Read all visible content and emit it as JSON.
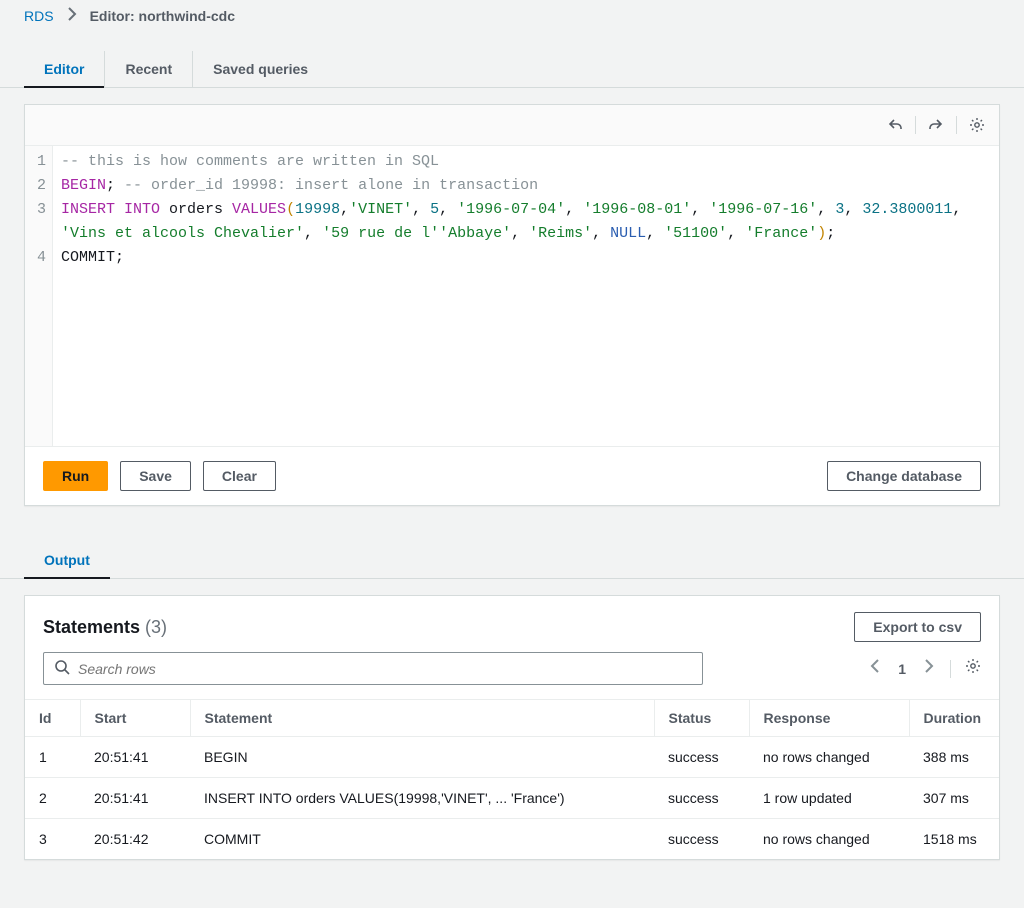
{
  "breadcrumb": {
    "root": "RDS",
    "current": "Editor: northwind-cdc"
  },
  "tabs": {
    "editor": "Editor",
    "recent": "Recent",
    "saved": "Saved queries"
  },
  "editor": {
    "line_numbers": [
      "1",
      "2",
      "3",
      "4"
    ],
    "l1_comment": "-- this is how comments are written in SQL",
    "l2_kw": "BEGIN",
    "l2_semi": ";",
    "l2_comment": " -- order_id 19998: insert alone in transaction",
    "l3_insert": "INSERT INTO",
    "l3_table": " orders ",
    "l3_values": "VALUES",
    "l3_open": "(",
    "l3_v1": "19998",
    "l3_c1": ",",
    "l3_v2": "'VINET'",
    "l3_c2": ", ",
    "l3_v3": "5",
    "l3_c3": ", ",
    "l3_v4": "'1996-07-04'",
    "l3_c4": ", ",
    "l3_v5": "'1996-08-01'",
    "l3_c5": ", ",
    "l3_v6": "'1996-07-16'",
    "l3_c6": ", ",
    "l3_v7": "3",
    "l3_c7": ", ",
    "l3_v8": "32.3800011",
    "l3_c8": ", ",
    "l3_v9": "'Vins et alcools Chevalier'",
    "l3_c9": ", ",
    "l3_v10": "'59 rue de l''Abbaye'",
    "l3_c10": ", ",
    "l3_v11": "'Reims'",
    "l3_c11": ", ",
    "l3_v12": "NULL",
    "l3_c12": ", ",
    "l3_v13": "'51100'",
    "l3_c13": ", ",
    "l3_v14": "'France'",
    "l3_close": ")",
    "l3_semi": ";",
    "l4": "COMMIT;"
  },
  "buttons": {
    "run": "Run",
    "save": "Save",
    "clear": "Clear",
    "change_db": "Change database"
  },
  "output_tab": "Output",
  "statements": {
    "title": "Statements",
    "count": "(3)",
    "export": "Export to csv",
    "search_placeholder": "Search rows",
    "page": "1",
    "columns": {
      "id": "Id",
      "start": "Start",
      "statement": "Statement",
      "status": "Status",
      "response": "Response",
      "duration": "Duration"
    },
    "rows": [
      {
        "id": "1",
        "start": "20:51:41",
        "statement": "BEGIN",
        "status": "success",
        "response": "no rows changed",
        "duration": "388 ms"
      },
      {
        "id": "2",
        "start": "20:51:41",
        "statement": "INSERT INTO orders VALUES(19998,'VINET', ... 'France')",
        "status": "success",
        "response": "1 row updated",
        "duration": "307 ms"
      },
      {
        "id": "3",
        "start": "20:51:42",
        "statement": "COMMIT",
        "status": "success",
        "response": "no rows changed",
        "duration": "1518 ms"
      }
    ]
  }
}
